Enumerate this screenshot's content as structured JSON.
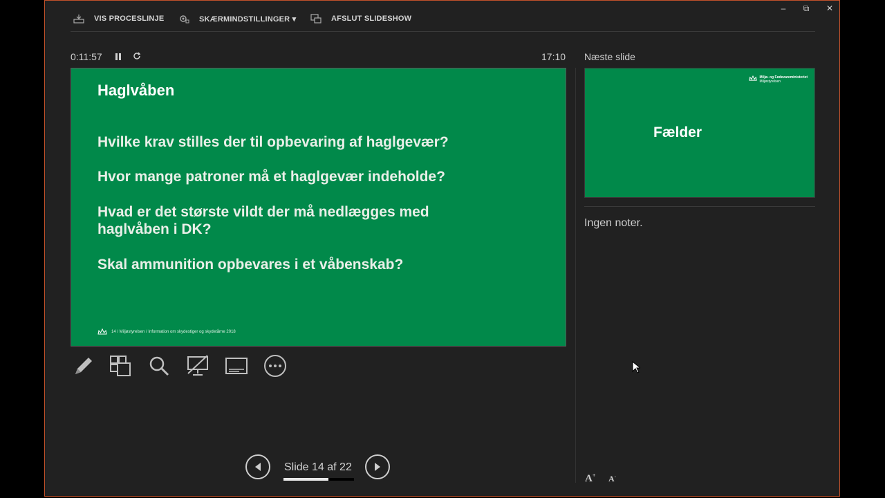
{
  "toolbar": {
    "show_taskbar": "VIS PROCESLINJE",
    "display_settings": "SKÆRMINDSTILLINGER ▾",
    "end_slideshow": "AFSLUT SLIDESHOW"
  },
  "window_controls": {
    "minimize": "–",
    "restore": "⧉",
    "close": "✕"
  },
  "timer": {
    "elapsed": "0:11:57",
    "clock": "17:10"
  },
  "next_label": "Næste slide",
  "current_slide": {
    "title": "Haglvåben",
    "questions": [
      "Hvilke krav stilles der til opbevaring af haglgevær?",
      "Hvor mange patroner må et haglgevær indeholde?",
      "Hvad er det største vildt der må nedlægges med haglvåben i DK?",
      "Skal ammunition opbevares i et våbenskab?"
    ],
    "footer": "14 / Miljøstyrelsen / Information om skydestiger og skydetårne 2018"
  },
  "next_slide": {
    "title": "Fælder",
    "logo_line1": "Miljø- og Fødevareministeriet",
    "logo_line2": "Miljøstyrelsen"
  },
  "notes": "Ingen noter.",
  "navigation": {
    "counter": "Slide 14 af 22",
    "current": 14,
    "total": 22,
    "progress": 0.636
  },
  "colors": {
    "slide_green": "#01894a",
    "window_border": "#c2512a",
    "background": "#212121"
  }
}
